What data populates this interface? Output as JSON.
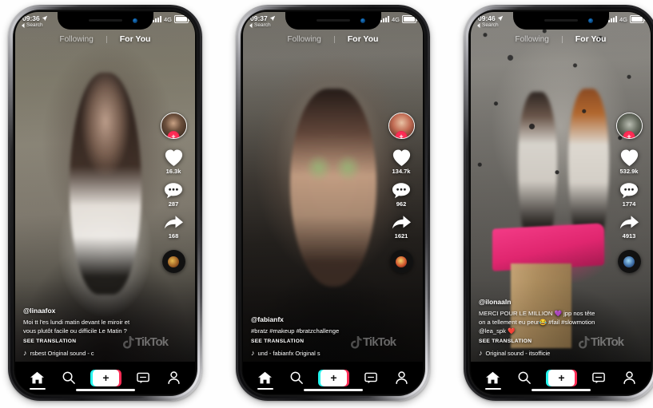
{
  "app": {
    "name": "TikTok"
  },
  "phones": [
    {
      "id": "phone-1",
      "status": {
        "time": "09:36",
        "back_label": "Search",
        "network": "4G"
      },
      "tabs": {
        "following": "Following",
        "for_you": "For You",
        "active": "For You"
      },
      "actions": {
        "like_count": "16.3k",
        "comment_count": "287",
        "share_count": "168",
        "follow_badge": "+"
      },
      "caption": {
        "handle": "@linaafox",
        "text": "Moi tt l'es lundi matin devant le miroir et vous plutôt facile  ou difficile Le Matin  ?",
        "translate_label": "SEE TRANSLATION",
        "sound": "rsbest   Original sound - c"
      }
    },
    {
      "id": "phone-2",
      "status": {
        "time": "09:37",
        "back_label": "Search",
        "network": "4G"
      },
      "tabs": {
        "following": "Following",
        "for_you": "For You",
        "active": "For You"
      },
      "actions": {
        "like_count": "134.7k",
        "comment_count": "962",
        "share_count": "1621",
        "follow_badge": "+"
      },
      "caption": {
        "handle": "@fabianfx",
        "text": "#bratz #makeup #bratzchallenge",
        "translate_label": "SEE TRANSLATION",
        "sound": "und - fabianfx   Original s"
      }
    },
    {
      "id": "phone-3",
      "status": {
        "time": "09:46",
        "back_label": "Search",
        "network": "4G"
      },
      "tabs": {
        "following": "Following",
        "for_you": "For You",
        "active": "For You"
      },
      "actions": {
        "like_count": "532.9k",
        "comment_count": "1774",
        "share_count": "4913",
        "follow_badge": "+"
      },
      "caption": {
        "handle": "@ilonaaln",
        "text": "MERCI POUR LE MILLION 💜 jpp nos tête on a tellement eu peur😂 #fail #slowmotion @lea_spk ❤️",
        "translate_label": "SEE TRANSLATION",
        "sound": "Original sound - itsofficie"
      }
    }
  ],
  "nav": {
    "items": [
      {
        "name": "home",
        "label": "Home",
        "active": true
      },
      {
        "name": "discover",
        "label": "Discover",
        "active": false
      },
      {
        "name": "create",
        "label": "+",
        "active": false
      },
      {
        "name": "inbox",
        "label": "Inbox",
        "active": false
      },
      {
        "name": "profile",
        "label": "Me",
        "active": false
      }
    ]
  },
  "colors": {
    "accent_pink": "#FE2C55",
    "accent_cyan": "#25F4EE",
    "background": "#FFFFFF",
    "nav_background": "#000000"
  },
  "watermark": {
    "text": "TikTok"
  }
}
